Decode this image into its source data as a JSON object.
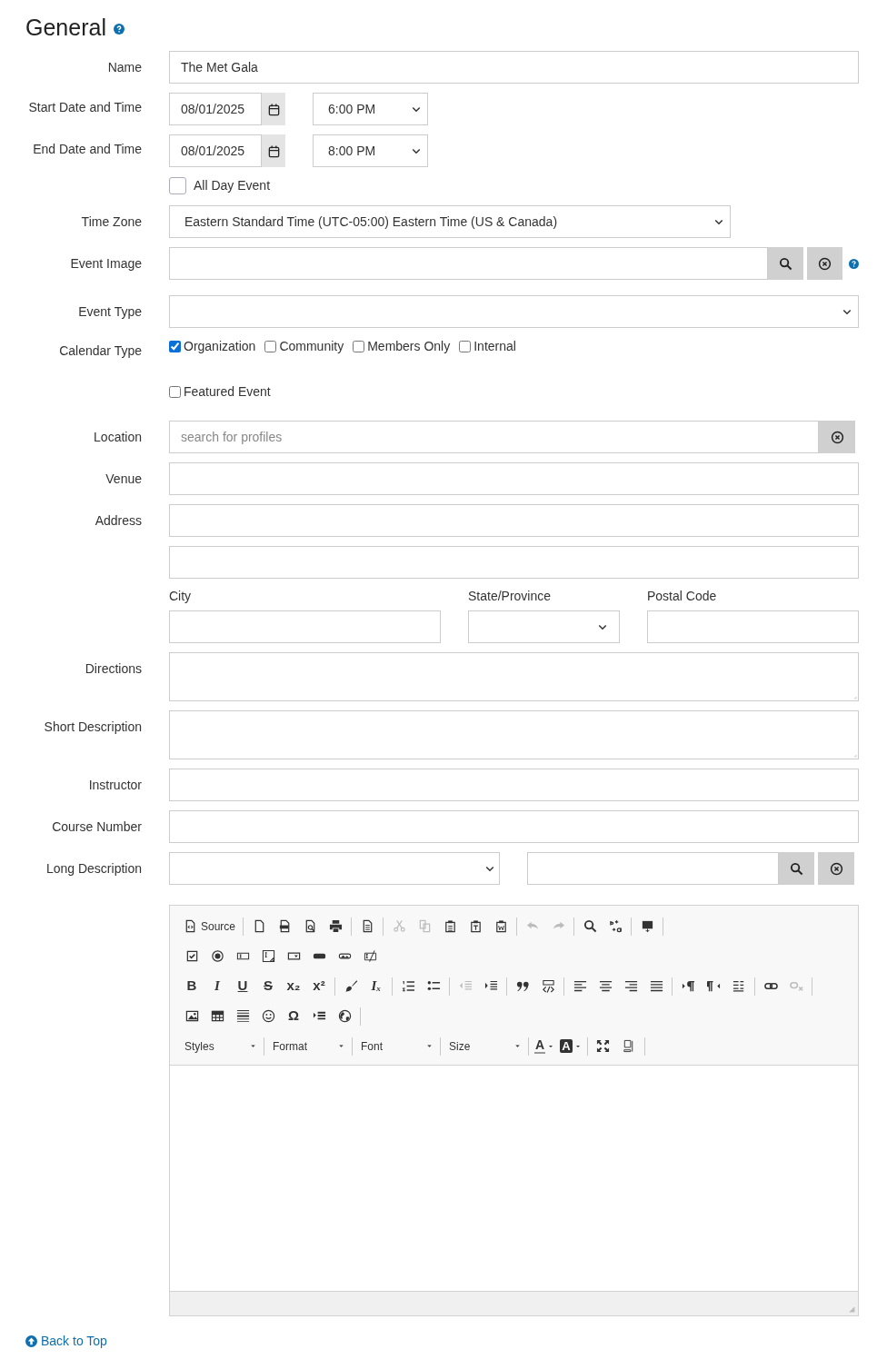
{
  "heading": "General",
  "fields": [
    {
      "kind": "text",
      "label": "Name",
      "value": "The Met Gala"
    },
    {
      "kind": "datetime",
      "label": "Start Date and Time",
      "date": "08/01/2025",
      "time": "6:00 PM"
    },
    {
      "kind": "datetime",
      "label": "End Date and Time",
      "date": "08/01/2025",
      "time": "8:00 PM"
    },
    {
      "kind": "toggle",
      "option": "All Day Event",
      "checked": false
    },
    {
      "kind": "select",
      "label": "Time Zone",
      "value": "Eastern Standard Time (UTC-05:00) Eastern Time (US & Canada)"
    },
    {
      "kind": "picker",
      "label": "Event Image"
    },
    {
      "kind": "select",
      "label": "Event Type"
    },
    {
      "kind": "checks",
      "label": "Calendar Type",
      "options": [
        {
          "label": "Organization",
          "checked": true
        },
        {
          "label": "Community",
          "checked": false
        },
        {
          "label": "Members Only",
          "checked": false
        },
        {
          "label": "Internal",
          "checked": false
        }
      ]
    },
    {
      "kind": "checks",
      "options": [
        {
          "label": "Featured Event",
          "checked": false
        }
      ]
    },
    {
      "kind": "search",
      "label": "Location",
      "placeholder": "search for profiles"
    },
    {
      "kind": "text",
      "label": "Venue"
    },
    {
      "kind": "text",
      "label": "Address"
    },
    {
      "kind": "text"
    },
    {
      "kind": "columns",
      "columns": [
        {
          "label": "City",
          "kind": "text"
        },
        {
          "label": "State/Province",
          "kind": "select"
        },
        {
          "label": "Postal Code",
          "kind": "text"
        }
      ]
    },
    {
      "kind": "textarea",
      "label": "Directions"
    },
    {
      "kind": "textarea",
      "label": "Short Description"
    },
    {
      "kind": "text",
      "label": "Instructor"
    },
    {
      "kind": "text",
      "label": "Course Number"
    },
    {
      "kind": "longdesc",
      "label": "Long Description"
    }
  ],
  "editor": {
    "toolbar": [
      [
        [
          {
            "kind": "source",
            "label": "Source",
            "disabled": false
          }
        ],
        [
          {
            "kind": "icon",
            "disabled": false
          },
          {
            "kind": "icon",
            "disabled": false
          },
          {
            "kind": "icon",
            "disabled": false
          },
          {
            "kind": "icon",
            "disabled": false
          }
        ],
        [
          {
            "kind": "icon",
            "disabled": false
          }
        ],
        [
          {
            "kind": "icon",
            "disabled": true
          },
          {
            "kind": "icon",
            "disabled": true
          },
          {
            "kind": "icon",
            "disabled": false
          },
          {
            "kind": "icon",
            "disabled": false
          },
          {
            "kind": "icon",
            "disabled": false
          }
        ],
        [
          {
            "kind": "icon",
            "disabled": true
          },
          {
            "kind": "icon",
            "disabled": true
          }
        ],
        [
          {
            "kind": "icon",
            "disabled": false
          },
          {
            "kind": "icon",
            "disabled": false
          }
        ],
        [
          {
            "kind": "icon",
            "disabled": false
          }
        ]
      ],
      [
        [
          {
            "kind": "icon",
            "disabled": false
          },
          {
            "kind": "icon",
            "disabled": false
          },
          {
            "kind": "icon",
            "disabled": false
          },
          {
            "kind": "icon",
            "disabled": false
          },
          {
            "kind": "icon",
            "disabled": false
          },
          {
            "kind": "icon",
            "disabled": false
          },
          {
            "kind": "icon",
            "disabled": false
          },
          {
            "kind": "icon",
            "disabled": false
          }
        ]
      ],
      [
        [
          {
            "kind": "glyph",
            "glyph": "B",
            "disabled": false
          },
          {
            "kind": "glyph",
            "glyph": "I",
            "disabled": false
          },
          {
            "kind": "glyph",
            "glyph": "U",
            "disabled": false
          },
          {
            "kind": "glyph",
            "glyph": "S",
            "disabled": false
          },
          {
            "kind": "glyph",
            "glyph": "x₂",
            "disabled": false
          },
          {
            "kind": "glyph",
            "glyph": "x²",
            "disabled": false
          }
        ],
        [
          {
            "kind": "icon",
            "disabled": false
          },
          {
            "kind": "glyph",
            "glyph": "Iₓ",
            "disabled": false
          }
        ],
        [
          {
            "kind": "icon",
            "disabled": false
          },
          {
            "kind": "icon",
            "disabled": false
          }
        ],
        [
          {
            "kind": "icon",
            "disabled": true
          },
          {
            "kind": "icon",
            "disabled": false
          }
        ],
        [
          {
            "kind": "icon",
            "disabled": false
          },
          {
            "kind": "icon",
            "disabled": false
          }
        ],
        [
          {
            "kind": "icon",
            "disabled": false
          },
          {
            "kind": "icon",
            "disabled": false
          },
          {
            "kind": "icon",
            "disabled": false
          },
          {
            "kind": "icon",
            "disabled": false
          }
        ],
        [
          {
            "kind": "icon",
            "disabled": false
          },
          {
            "kind": "icon",
            "disabled": false
          },
          {
            "kind": "icon",
            "disabled": false
          }
        ],
        [
          {
            "kind": "icon",
            "disabled": false
          },
          {
            "kind": "icon",
            "disabled": true
          }
        ]
      ],
      [
        [
          {
            "kind": "icon",
            "disabled": false
          },
          {
            "kind": "icon",
            "disabled": false
          },
          {
            "kind": "icon",
            "disabled": false
          },
          {
            "kind": "icon",
            "disabled": false
          },
          {
            "kind": "glyph",
            "glyph": "Ω",
            "disabled": false
          },
          {
            "kind": "icon",
            "disabled": false
          },
          {
            "kind": "icon",
            "disabled": false
          }
        ]
      ],
      [
        [
          {
            "kind": "combo",
            "label": "Styles",
            "disabled": false
          }
        ],
        [
          {
            "kind": "combo",
            "label": "Format",
            "disabled": false
          }
        ],
        [
          {
            "kind": "combo",
            "label": "Font",
            "disabled": false
          }
        ],
        [
          {
            "kind": "combo",
            "label": "Size",
            "disabled": false
          }
        ],
        [
          {
            "kind": "color",
            "glyph": "A",
            "disabled": false
          },
          {
            "kind": "colorbg",
            "glyph": "A",
            "disabled": false
          }
        ],
        [
          {
            "kind": "icon",
            "disabled": false
          },
          {
            "kind": "icon",
            "disabled": false
          }
        ]
      ]
    ]
  },
  "back_to_top": "Back to Top"
}
